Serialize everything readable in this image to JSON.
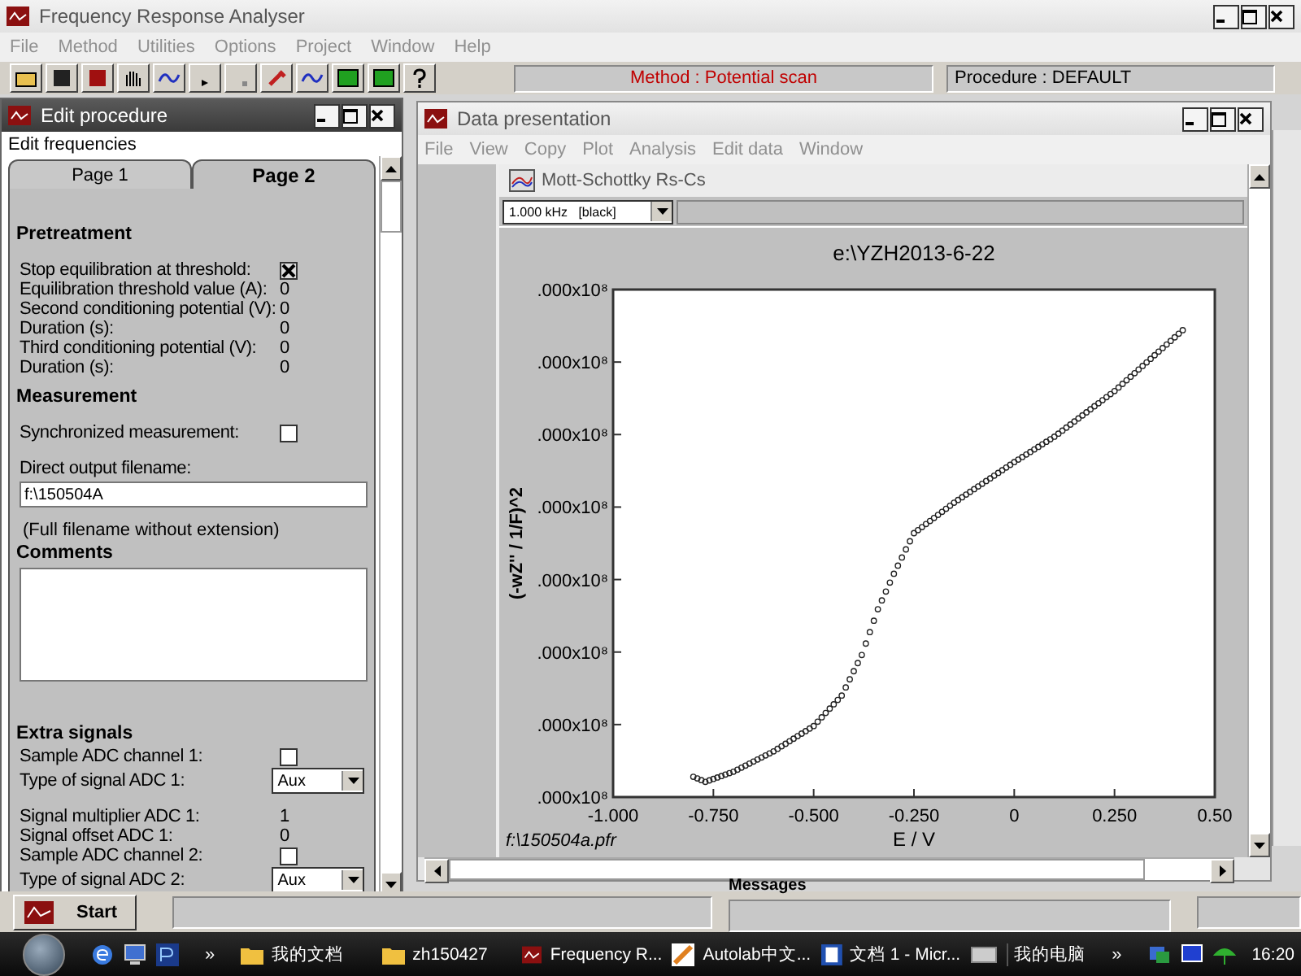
{
  "app": {
    "title": "Frequency Response Analyser",
    "menu": [
      "File",
      "Method",
      "Utilities",
      "Options",
      "Project",
      "Window",
      "Help"
    ],
    "method_status": "Method : Potential scan",
    "procedure_status": "Procedure : DEFAULT"
  },
  "edit_procedure": {
    "title": "Edit procedure",
    "menu": [
      "Edit frequencies"
    ],
    "tabs": [
      {
        "label": "Page 1",
        "selected": false
      },
      {
        "label": "Page 2",
        "selected": true
      }
    ],
    "items": [
      {
        "kind": "heading",
        "label": "Pretreatment"
      },
      {
        "kind": "check",
        "label": "Stop equilibration at threshold:",
        "checked": true
      },
      {
        "kind": "value",
        "label": "Equilibration threshold value (A):",
        "value": "0"
      },
      {
        "kind": "value",
        "label": "Second conditioning potential (V):",
        "value": "0"
      },
      {
        "kind": "value",
        "label": "Duration (s):",
        "value": "0"
      },
      {
        "kind": "value",
        "label": "Third conditioning potential (V):",
        "value": "0"
      },
      {
        "kind": "value",
        "label": "Duration (s):",
        "value": "0"
      },
      {
        "kind": "heading",
        "label": "Measurement"
      },
      {
        "kind": "check",
        "label": "Synchronized measurement:",
        "checked": false
      },
      {
        "kind": "field",
        "label": "Direct output filename:",
        "value": "f:\\150504A"
      },
      {
        "kind": "note",
        "label": "(Full filename without extension)"
      },
      {
        "kind": "textarea",
        "label": "Comments"
      },
      {
        "kind": "heading",
        "label": "Extra signals"
      },
      {
        "kind": "check",
        "label": "Sample ADC channel 1:",
        "checked": false
      },
      {
        "kind": "select",
        "label": "Type of signal ADC 1:",
        "value": "Aux"
      },
      {
        "kind": "value",
        "label": "Signal multiplier ADC 1:",
        "value": "1"
      },
      {
        "kind": "value",
        "label": "Signal offset ADC 1:",
        "value": "0"
      },
      {
        "kind": "check",
        "label": "Sample ADC channel 2:",
        "checked": false
      },
      {
        "kind": "select",
        "label": "Type of signal ADC 2:",
        "value": "Aux"
      }
    ]
  },
  "data_presentation": {
    "title": "Data presentation",
    "menu": [
      "File",
      "View",
      "Copy",
      "Plot",
      "Analysis",
      "Edit data",
      "Window"
    ],
    "plot_window": {
      "title": "Mott-Schottky Rs-Cs",
      "frequency": "1.000 kHz   [black]",
      "chart": {
        "title": "e:\\YZH2013-6-22",
        "ylabel": "(-wZ'' / 1/F)^2",
        "xlabel": "E / V",
        "yticks": [
          ".000x10⁸",
          ".000x10⁸",
          ".000x10⁸",
          ".000x10⁸",
          ".000x10⁸",
          ".000x10⁸",
          ".000x10⁸",
          ".000x10⁸"
        ],
        "xticks": [
          "-1.000",
          "-0.750",
          "-0.500",
          "-0.250",
          "0",
          "0.250",
          "0.50"
        ],
        "file": "f:\\150504a.pfr"
      }
    }
  },
  "bottom": {
    "start": "Start",
    "messages": "Messages"
  },
  "taskbar": {
    "more": "»",
    "windows": [
      "我的文档",
      "zh150427",
      "Frequency R...",
      "Autolab中文...",
      "文档 1 - Micr..."
    ],
    "tray_label": "我的电脑",
    "tray_more": "»",
    "clock": "16:20"
  }
}
